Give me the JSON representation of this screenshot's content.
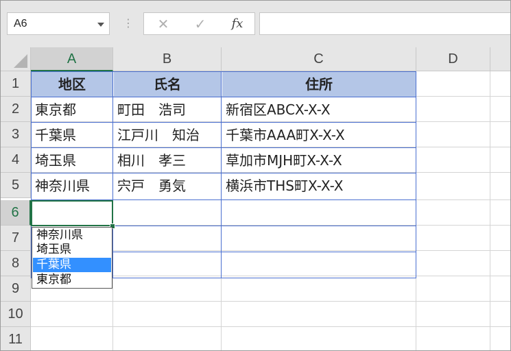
{
  "formula_bar": {
    "name_box": "A6",
    "cancel_glyph": "✕",
    "enter_glyph": "✓",
    "fx_label": "fx",
    "formula": ""
  },
  "columns": [
    "A",
    "B",
    "C",
    "D"
  ],
  "rows": [
    "1",
    "2",
    "3",
    "4",
    "5",
    "6",
    "7",
    "8",
    "9",
    "10",
    "11"
  ],
  "table": {
    "headers": [
      "地区",
      "氏名",
      "住所"
    ],
    "data": [
      [
        "東京都",
        "町田　浩司",
        "新宿区ABCX-X-X"
      ],
      [
        "千葉県",
        "江戸川　知治",
        "千葉市AAA町X-X-X"
      ],
      [
        "埼玉県",
        "相川　孝三",
        "草加市MJH町X-X-X"
      ],
      [
        "神奈川県",
        "宍戸　勇気",
        "横浜市THS町X-X-X"
      ]
    ]
  },
  "active_cell": "A6",
  "dropdown": {
    "options": [
      "神奈川県",
      "埼玉県",
      "千葉県",
      "東京都"
    ],
    "highlighted": "千葉県"
  },
  "colors": {
    "header_fill": "#b4c6e7",
    "table_border": "#4a6fd0",
    "selection": "#217346",
    "highlight": "#3390ff"
  }
}
